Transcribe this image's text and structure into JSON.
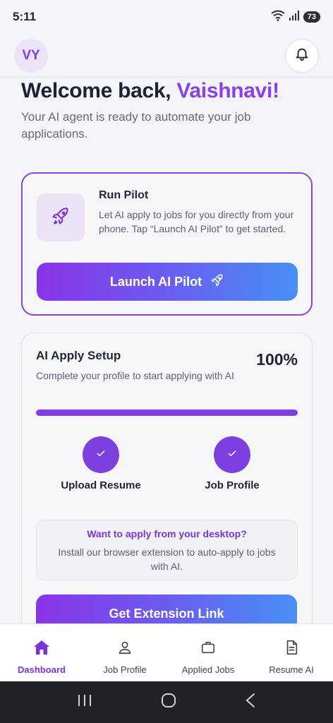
{
  "status_bar": {
    "time": "5:11",
    "battery": "73"
  },
  "header": {
    "avatar_initials": "VY"
  },
  "welcome": {
    "greeting": "Welcome back,",
    "name": "Vaishnavi!",
    "subtitle": "Your AI agent is ready to automate your job applications."
  },
  "pilot": {
    "title": "Run Pilot",
    "description": "Let AI apply to jobs for you directly from your phone. Tap “Launch AI Pilot” to get started.",
    "button_label": "Launch AI Pilot"
  },
  "setup": {
    "title": "AI Apply Setup",
    "description": "Complete your profile to start applying with AI",
    "percent_label": "100%",
    "progress_fraction": 1.0,
    "steps": [
      {
        "label": "Upload Resume",
        "completed": true
      },
      {
        "label": "Job Profile",
        "completed": true
      }
    ],
    "extension": {
      "title": "Want to apply from your desktop?",
      "description": "Install our browser extension to auto-apply to jobs with AI."
    },
    "extension_button_label": "Get Extension Link"
  },
  "bottom_nav": [
    {
      "label": "Dashboard",
      "icon": "home-icon",
      "active": true
    },
    {
      "label": "Job Profile",
      "icon": "person-icon",
      "active": false
    },
    {
      "label": "Applied Jobs",
      "icon": "briefcase-icon",
      "active": false
    },
    {
      "label": "Resume AI",
      "icon": "document-icon",
      "active": false
    }
  ],
  "colors": {
    "accent": "#8a3ff0",
    "gradient_start": "#8a34e8",
    "gradient_end": "#4790f4",
    "nav_active": "#7b35d6"
  }
}
